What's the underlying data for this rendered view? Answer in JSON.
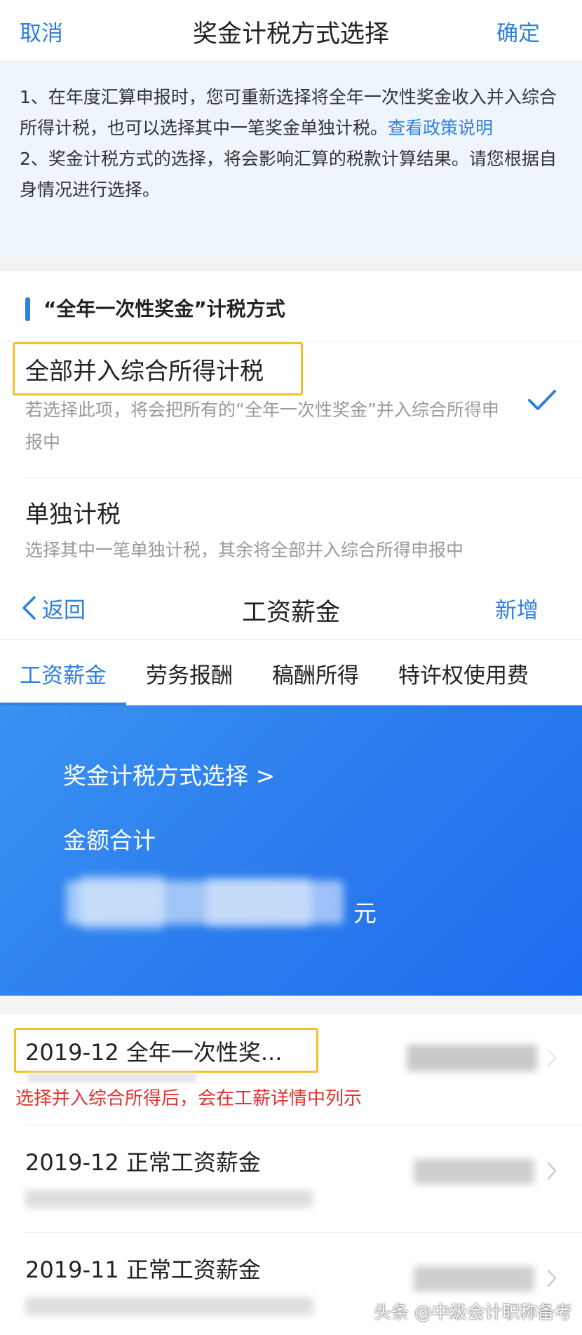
{
  "screen1": {
    "header": {
      "cancel": "取消",
      "title": "奖金计税方式选择",
      "confirm": "确定"
    },
    "notice": {
      "p1": "1、在年度汇算申报时，您可重新选择将全年一次性奖金收入并入综合所得计税，也可以选择其中一笔奖金单独计税。",
      "p1_link": "查看政策说明",
      "p2": "2、奖金计税方式的选择，将会影响汇算的税款计算结果。请您根据自身情况进行选择。"
    },
    "section_title": "“全年一次性奖金”计税方式",
    "options": [
      {
        "title": "全部并入综合所得计税",
        "desc": "若选择此项，将会把所有的“全年一次性奖金”并入综合所得申报中",
        "selected": true
      },
      {
        "title": "单独计税",
        "desc": "选择其中一笔单独计税，其余将全部并入综合所得申报中",
        "selected": false
      }
    ]
  },
  "screen2": {
    "header": {
      "back": "返回",
      "title": "工资薪金",
      "add": "新增"
    },
    "tabs": [
      "工资薪金",
      "劳务报酬",
      "稿酬所得",
      "特许权使用费"
    ],
    "active_tab": 0,
    "banner": {
      "link": "奖金计税方式选择 >",
      "total_label": "金额合计",
      "unit": "元"
    },
    "list": [
      {
        "title": "2019-12 全年一次性奖...",
        "note": "选择并入综合所得后，会在工薪详情中列示"
      },
      {
        "title": "2019-12 正常工资薪金"
      },
      {
        "title": "2019-11 正常工资薪金"
      }
    ]
  },
  "watermark": "头条 @中级会计职称备考",
  "colors": {
    "accent": "#2f7fe0",
    "highlight": "#f2c128",
    "note_red": "#e0342e"
  }
}
